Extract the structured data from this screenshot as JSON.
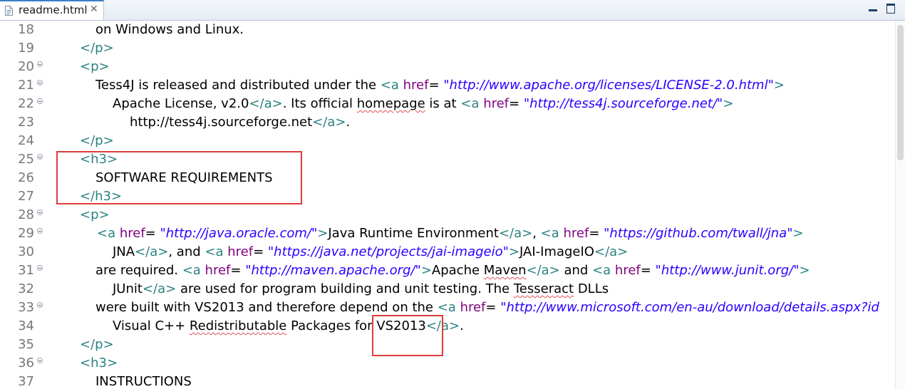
{
  "tab": {
    "title": "readme.html",
    "close": "✕"
  },
  "icons": {
    "file": "html-file-icon",
    "close": "close-icon",
    "minimize": "minimize-icon",
    "maximize": "maximize-icon"
  },
  "editor": {
    "lines": [
      {
        "no": "18",
        "fold": false,
        "indent": 74,
        "parts": [
          {
            "t": "on Windows and Linux.",
            "c": ""
          }
        ]
      },
      {
        "no": "19",
        "fold": false,
        "indent": 52,
        "parts": [
          {
            "t": "</p>",
            "c": "tag"
          }
        ]
      },
      {
        "no": "20",
        "fold": true,
        "indent": 52,
        "parts": [
          {
            "t": "<p>",
            "c": "tag"
          }
        ]
      },
      {
        "no": "21",
        "fold": true,
        "indent": 74,
        "parts": [
          {
            "t": "Tess4J is released and distributed under the ",
            "c": ""
          },
          {
            "t": "<a ",
            "c": "tag"
          },
          {
            "t": "href",
            "c": "attr"
          },
          {
            "t": "= ",
            "c": "eq"
          },
          {
            "t": "\"http://www.apache.org/licenses/LICENSE-2.0.html\"",
            "c": "val"
          },
          {
            "t": ">",
            "c": "tag"
          }
        ]
      },
      {
        "no": "22",
        "fold": true,
        "indent": 98,
        "parts": [
          {
            "t": "Apache License, v2.0",
            "c": ""
          },
          {
            "t": "</a>",
            "c": "tag"
          },
          {
            "t": ". Its official ",
            "c": ""
          },
          {
            "t": "homepage",
            "c": "spell"
          },
          {
            "t": " is at ",
            "c": ""
          },
          {
            "t": "<a ",
            "c": "tag"
          },
          {
            "t": "href",
            "c": "attr"
          },
          {
            "t": "= ",
            "c": "eq"
          },
          {
            "t": "\"http://tess4j.sourceforge.net/\"",
            "c": "val"
          },
          {
            "t": ">",
            "c": "tag"
          }
        ]
      },
      {
        "no": "23",
        "fold": false,
        "indent": 122,
        "parts": [
          {
            "t": "http://tess4j.sourceforge.net",
            "c": ""
          },
          {
            "t": "</a>",
            "c": "tag"
          },
          {
            "t": ".",
            "c": ""
          }
        ]
      },
      {
        "no": "24",
        "fold": false,
        "indent": 52,
        "parts": [
          {
            "t": "</p>",
            "c": "tag"
          }
        ]
      },
      {
        "no": "25",
        "fold": true,
        "indent": 52,
        "parts": [
          {
            "t": "<h3>",
            "c": "tag"
          }
        ]
      },
      {
        "no": "26",
        "fold": false,
        "indent": 74,
        "parts": [
          {
            "t": "SOFTWARE REQUIREMENTS",
            "c": ""
          }
        ]
      },
      {
        "no": "27",
        "fold": false,
        "indent": 52,
        "parts": [
          {
            "t": "</h3>",
            "c": "tag"
          }
        ]
      },
      {
        "no": "28",
        "fold": true,
        "indent": 52,
        "parts": [
          {
            "t": "<p>",
            "c": "tag"
          }
        ]
      },
      {
        "no": "29",
        "fold": true,
        "indent": 76,
        "parts": [
          {
            "t": "<a ",
            "c": "tag"
          },
          {
            "t": "href",
            "c": "attr"
          },
          {
            "t": "= ",
            "c": "eq"
          },
          {
            "t": "\"http://java.oracle.com/\"",
            "c": "val"
          },
          {
            "t": ">",
            "c": "tag"
          },
          {
            "t": "Java Runtime Environment",
            "c": ""
          },
          {
            "t": "</a>",
            "c": "tag"
          },
          {
            "t": ", ",
            "c": ""
          },
          {
            "t": "<a ",
            "c": "tag"
          },
          {
            "t": "href",
            "c": "attr"
          },
          {
            "t": "= ",
            "c": "eq"
          },
          {
            "t": "\"https://github.com/twall/jna\"",
            "c": "val"
          },
          {
            "t": ">",
            "c": "tag"
          }
        ]
      },
      {
        "no": "30",
        "fold": false,
        "indent": 98,
        "parts": [
          {
            "t": "JNA",
            "c": ""
          },
          {
            "t": "</a>",
            "c": "tag"
          },
          {
            "t": ", and ",
            "c": ""
          },
          {
            "t": "<a ",
            "c": "tag"
          },
          {
            "t": "href",
            "c": "attr"
          },
          {
            "t": "= ",
            "c": "eq"
          },
          {
            "t": "\"https://java.net/projects/jai-imageio\"",
            "c": "val"
          },
          {
            "t": ">",
            "c": "tag"
          },
          {
            "t": "JAI-ImageIO",
            "c": ""
          },
          {
            "t": "</a>",
            "c": "tag"
          }
        ]
      },
      {
        "no": "31",
        "fold": true,
        "indent": 74,
        "parts": [
          {
            "t": "are required. ",
            "c": ""
          },
          {
            "t": "<a ",
            "c": "tag"
          },
          {
            "t": "href",
            "c": "attr"
          },
          {
            "t": "= ",
            "c": "eq"
          },
          {
            "t": "\"http://maven.apache.org/\"",
            "c": "val"
          },
          {
            "t": ">",
            "c": "tag"
          },
          {
            "t": "Apache ",
            "c": ""
          },
          {
            "t": "Maven",
            "c": "spell"
          },
          {
            "t": "</a>",
            "c": "tag"
          },
          {
            "t": " and ",
            "c": ""
          },
          {
            "t": "<a ",
            "c": "tag"
          },
          {
            "t": "href",
            "c": "attr"
          },
          {
            "t": "= ",
            "c": "eq"
          },
          {
            "t": "\"http://www.junit.org/\"",
            "c": "val"
          },
          {
            "t": ">",
            "c": "tag"
          }
        ]
      },
      {
        "no": "32",
        "fold": false,
        "indent": 98,
        "parts": [
          {
            "t": "JUnit",
            "c": ""
          },
          {
            "t": "</a>",
            "c": "tag"
          },
          {
            "t": " are used for program building and unit testing. The ",
            "c": ""
          },
          {
            "t": "Tesseract",
            "c": "spell"
          },
          {
            "t": " DLLs",
            "c": ""
          }
        ]
      },
      {
        "no": "33",
        "fold": true,
        "indent": 74,
        "parts": [
          {
            "t": "were built with VS2013 and therefore depend on the ",
            "c": ""
          },
          {
            "t": "<a ",
            "c": "tag"
          },
          {
            "t": "href",
            "c": "attr"
          },
          {
            "t": "= ",
            "c": "eq"
          },
          {
            "t": "\"http://www.microsoft.com/en-au/download/details.aspx?id",
            "c": "val"
          }
        ]
      },
      {
        "no": "34",
        "fold": false,
        "indent": 98,
        "parts": [
          {
            "t": "Visual C++ ",
            "c": ""
          },
          {
            "t": "Redistributable",
            "c": "spell"
          },
          {
            "t": " Packages for VS2013",
            "c": ""
          },
          {
            "t": "</a>",
            "c": "tag"
          },
          {
            "t": ".",
            "c": ""
          }
        ]
      },
      {
        "no": "35",
        "fold": false,
        "indent": 52,
        "parts": [
          {
            "t": "</p>",
            "c": "tag"
          }
        ]
      },
      {
        "no": "36",
        "fold": true,
        "indent": 52,
        "parts": [
          {
            "t": "<h3>",
            "c": "tag"
          }
        ]
      },
      {
        "no": "37",
        "fold": false,
        "indent": 74,
        "parts": [
          {
            "t": "INSTRUCTIONS",
            "c": ""
          }
        ]
      }
    ]
  },
  "colors": {
    "tag": "#2c8282",
    "attr": "#7f007f",
    "value": "#2a00ff",
    "highlight": "#e03c3c",
    "lineno": "#787878"
  }
}
